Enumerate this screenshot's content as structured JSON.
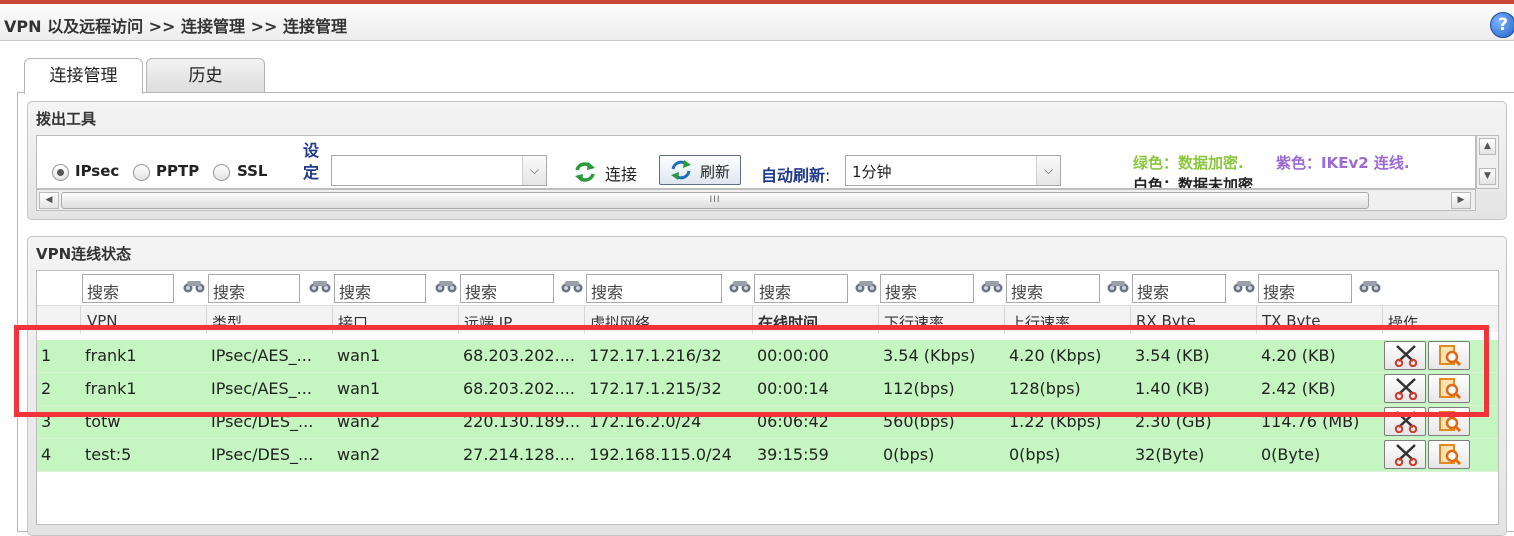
{
  "breadcrumb": "VPN 以及远程访问 >> 连接管理 >> 连接管理",
  "help_icon": "?",
  "tabs": [
    {
      "label": "连接管理",
      "active": true
    },
    {
      "label": "历史",
      "active": false
    }
  ],
  "dialout": {
    "title": "拨出工具",
    "protocols": [
      {
        "label": "IPsec",
        "checked": true
      },
      {
        "label": "PPTP",
        "checked": false
      },
      {
        "label": "SSL",
        "checked": false
      }
    ],
    "profile_label": "设定",
    "profile_value": "",
    "connect_label": "连接",
    "refresh_label": "刷新",
    "auto_refresh_label": "自动刷新",
    "auto_refresh_colon": ":",
    "auto_refresh_value": "1分钟",
    "legend_green": "绿色：数据加密.",
    "legend_purple": "紫色：IKEv2 连线.",
    "legend_white": "白色：数据未加密",
    "scroll_thumb": "III"
  },
  "status": {
    "title": "VPN连线状态",
    "search_placeholder": "搜索",
    "columns": [
      "VPN",
      "类型",
      "接口",
      "远端 IP",
      "虚拟网络",
      "在线时间",
      "下行速率",
      "上行速率",
      "RX Byte",
      "TX Byte",
      "操作"
    ],
    "rows": [
      {
        "index": "1",
        "vpn": "frank1",
        "type": "IPsec/AES_...",
        "iface": "wan1",
        "remote_ip": "68.203.202....",
        "vnet": "172.17.1.216/32",
        "uptime": "00:00:00",
        "down": "3.54 (Kbps)",
        "up": "4.20 (Kbps)",
        "rx": "3.54 (KB)",
        "tx": "4.20 (KB)"
      },
      {
        "index": "2",
        "vpn": "frank1",
        "type": "IPsec/AES_...",
        "iface": "wan1",
        "remote_ip": "68.203.202....",
        "vnet": "172.17.1.215/32",
        "uptime": "00:00:14",
        "down": "112(bps)",
        "up": "128(bps)",
        "rx": "1.40 (KB)",
        "tx": "2.42 (KB)"
      },
      {
        "index": "3",
        "vpn": "totw",
        "type": "IPsec/DES_...",
        "iface": "wan2",
        "remote_ip": "220.130.189...",
        "vnet": "172.16.2.0/24",
        "uptime": "06:06:42",
        "down": "560(bps)",
        "up": "1.22 (Kbps)",
        "rx": "2.30 (GB)",
        "tx": "114.76 (MB)"
      },
      {
        "index": "4",
        "vpn": "test:5",
        "type": "IPsec/DES_...",
        "iface": "wan2",
        "remote_ip": "27.214.128....",
        "vnet": "192.168.115.0/24",
        "uptime": "39:15:59",
        "down": "0(bps)",
        "up": "0(bps)",
        "rx": "32(Byte)",
        "tx": "0(Byte)"
      }
    ]
  },
  "colors": {
    "row_green": "#c5f5c0",
    "highlight": "#f2333a",
    "legend_green": "#8cc63f",
    "legend_purple": "#9b6ad6"
  }
}
